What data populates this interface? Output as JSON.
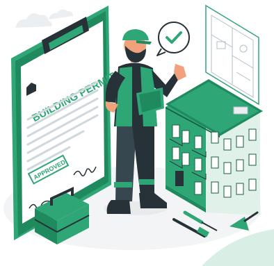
{
  "illustration": {
    "permit_title": "BUILDING PERMIT",
    "stamp_text": "APPROVED"
  },
  "colors": {
    "primary": "#2fa675",
    "dark": "#263238",
    "light_green": "#e6f5ee",
    "skin": "#f1a27c",
    "white": "#ffffff"
  },
  "icons": [
    "checkmark-bubble-icon",
    "home-icon",
    "toolbox-icon",
    "hammer-icon",
    "screwdriver-icon",
    "trowel-icon"
  ]
}
